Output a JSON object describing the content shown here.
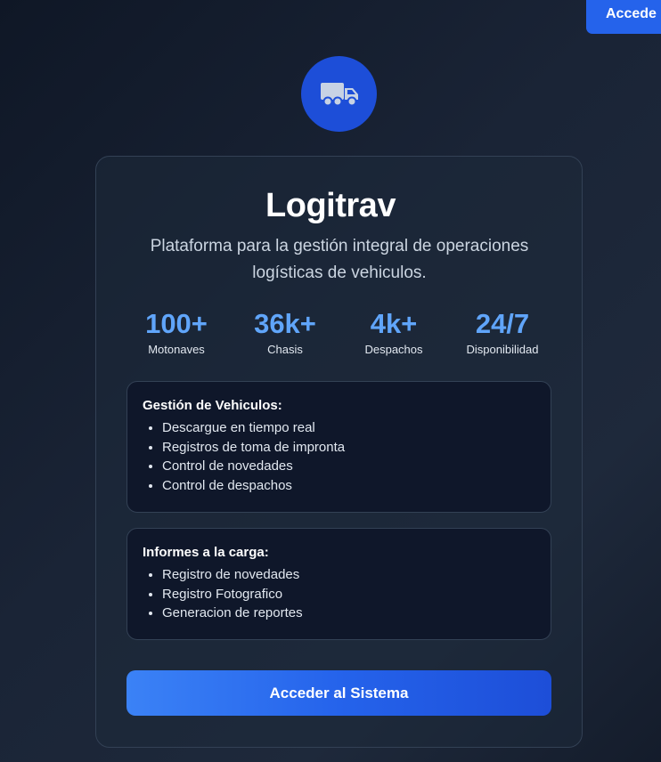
{
  "header": {
    "access_button_label": "Accede"
  },
  "brand": {
    "logo_icon": "truck-icon",
    "title": "Logitrav",
    "subtitle": "Plataforma para la gestión integral de operaciones logísticas de vehiculos."
  },
  "stats": [
    {
      "value": "100+",
      "label": "Motonaves"
    },
    {
      "value": "36k+",
      "label": "Chasis"
    },
    {
      "value": "4k+",
      "label": "Despachos"
    },
    {
      "value": "24/7",
      "label": "Disponibilidad"
    }
  ],
  "sections": [
    {
      "title": "Gestión de Vehiculos:",
      "items": [
        "Descargue en tiempo real",
        "Registros de toma de impronta",
        "Control de novedades",
        "Control de despachos"
      ]
    },
    {
      "title": "Informes a la carga:",
      "items": [
        "Registro de novedades",
        "Registro Fotografico",
        "Generacion de reportes"
      ]
    }
  ],
  "cta": {
    "label": "Acceder al Sistema"
  },
  "colors": {
    "accent": "#2563eb",
    "stat_value": "#60a5fa",
    "logo_bg": "#1d4ed8"
  }
}
